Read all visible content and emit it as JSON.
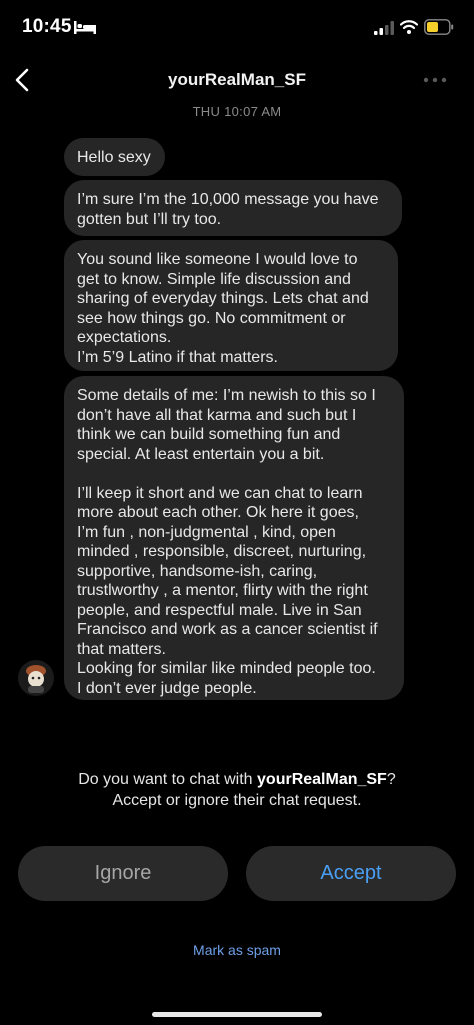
{
  "status": {
    "time": "10:45"
  },
  "header": {
    "title": "yourRealMan_SF",
    "timestamp": "THU 10:07 AM"
  },
  "messages": [
    {
      "text": "Hello sexy"
    },
    {
      "text": "I’m sure I’m the 10,000 message you have\ngotten but I’ll try too."
    },
    {
      "text": "You sound like someone I would love to\nget to know. Simple life discussion and\nsharing of everyday things. Lets chat and\nsee how things go. No commitment or\nexpectations.\nI’m 5’9 Latino if that matters."
    },
    {
      "text": "Some details of me: I’m newish to this so I\ndon’t have all that karma and such but I\nthink we can build something fun and\nspecial. At least entertain you a bit.\n\nI’ll keep it short and we can chat to learn\nmore about each other. Ok here it goes,\nI’m fun , non-judgmental , kind, open\nminded , responsible, discreet, nurturing,\nsupportive, handsome-ish, caring,\ntrustlworthy , a mentor, flirty with the right\npeople, and respectful  male. Live in San\nFrancisco and work as a cancer scientist if\nthat matters.\nLooking for similar like minded people too.\nI don’t ever judge people."
    }
  ],
  "request": {
    "prompt_prefix": "Do you want to chat with ",
    "username": "yourRealMan_SF",
    "prompt_suffix": "?",
    "line2": "Accept or ignore their chat request."
  },
  "actions": {
    "ignore_label": "Ignore",
    "accept_label": "Accept",
    "spam_label": "Mark as spam"
  },
  "colors": {
    "accent": "#4a9ff5",
    "bubble": "#262626",
    "background": "#000000"
  },
  "icons": [
    "bed-icon",
    "signal-icon",
    "wifi-icon",
    "battery-icon",
    "back-arrow-icon",
    "more-dots-icon",
    "avatar"
  ]
}
